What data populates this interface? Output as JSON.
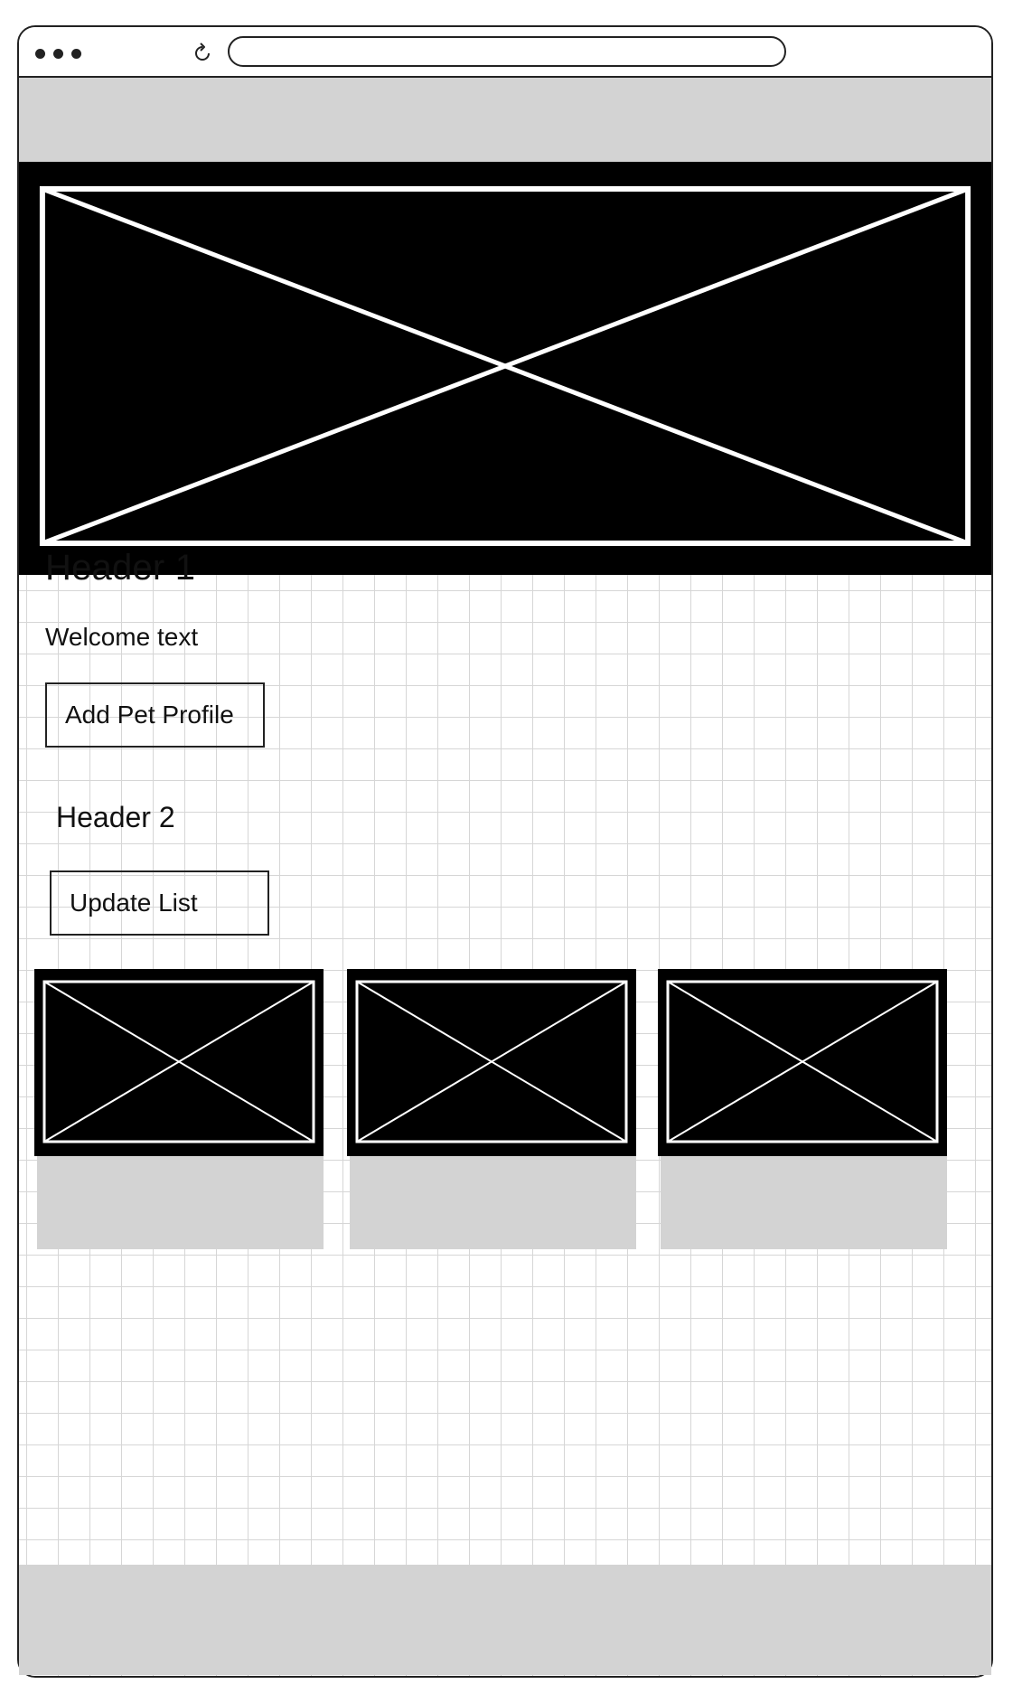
{
  "browser": {
    "reload_icon": "reload-icon",
    "menu_icon": "more-dots-icon",
    "address": ""
  },
  "hero": {
    "image_placeholder_icon": "image-placeholder-icon"
  },
  "content": {
    "header_1": "Header 1",
    "welcome_text": "Welcome text",
    "add_pet_profile_label": "Add Pet Profile",
    "header_2": "Header 2",
    "update_list_label": "Update List"
  },
  "cards": [
    {
      "image_icon": "image-placeholder-icon"
    },
    {
      "image_icon": "image-placeholder-icon"
    },
    {
      "image_icon": "image-placeholder-icon"
    }
  ],
  "colors": {
    "placeholder_gray": "#d3d3d3",
    "image_fill": "#000000",
    "outline": "#222222",
    "grid_line": "#d6d6d6"
  }
}
